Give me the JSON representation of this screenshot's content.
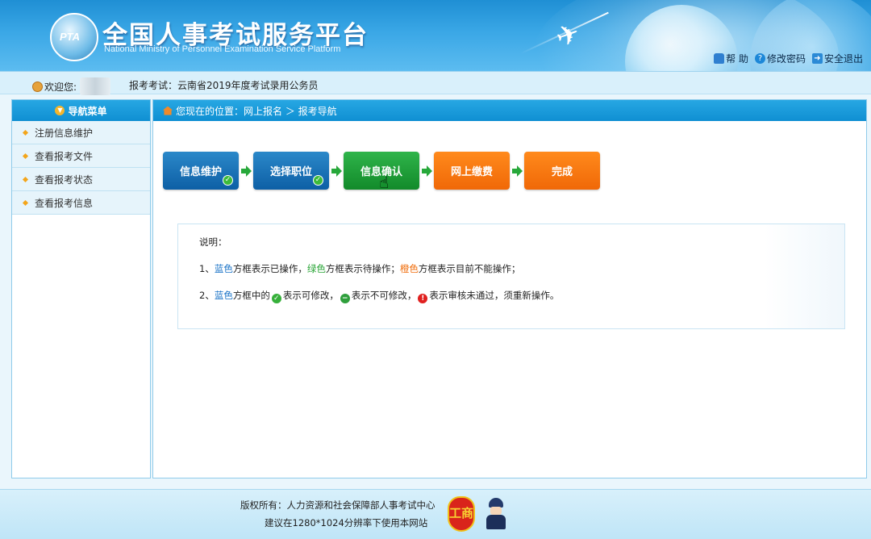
{
  "header": {
    "logo_text": "PTA",
    "title": "全国人事考试服务平台",
    "subtitle": "National Ministry of Personnel Examination Service Platform",
    "links": [
      {
        "label": "帮 助",
        "icon": "lock-icon"
      },
      {
        "label": "修改密码",
        "icon": "question-icon"
      },
      {
        "label": "安全退出",
        "icon": "exit-icon"
      }
    ]
  },
  "userbar": {
    "welcome": "欢迎您:",
    "exam_label": "报考考试：云南省2019年度考试录用公务员"
  },
  "sidebar": {
    "title": "导航菜单",
    "items": [
      {
        "label": "注册信息维护"
      },
      {
        "label": "查看报考文件"
      },
      {
        "label": "查看报考状态"
      },
      {
        "label": "查看报考信息"
      }
    ]
  },
  "main": {
    "breadcrumb": "您现在的位置：网上报名 ＞ 报考导航",
    "steps": [
      {
        "label": "信息维护",
        "color": "blue",
        "done": true
      },
      {
        "label": "选择职位",
        "color": "blue",
        "done": true
      },
      {
        "label": "信息确认",
        "color": "green",
        "done": false
      },
      {
        "label": "网上缴费",
        "color": "orange",
        "done": false
      },
      {
        "label": "完成",
        "color": "orange",
        "done": false
      }
    ],
    "notes": {
      "title": "说明：",
      "line1_prefix": "1、",
      "line1_blue": "蓝色",
      "line1_a": "方框表示已操作，",
      "line1_green": "绿色",
      "line1_b": "方框表示待操作；",
      "line1_orange": "橙色",
      "line1_c": "方框表示目前不能操作；",
      "line2_prefix": "2、",
      "line2_blue": "蓝色",
      "line2_a": "方框中的",
      "line2_b": "表示可修改，",
      "line2_c": "表示不可修改，",
      "line2_d": "表示审核未通过，须重新操作。"
    }
  },
  "footer": {
    "copyright": "版权所有：人力资源和社会保障部人事考试中心",
    "resolution": "建议在1280*1024分辨率下使用本网站",
    "badge_text": "工商"
  },
  "colors": {
    "blue": "#0d5fa5",
    "green": "#128a2a",
    "orange": "#f06807",
    "header": "#1f8fd4"
  }
}
